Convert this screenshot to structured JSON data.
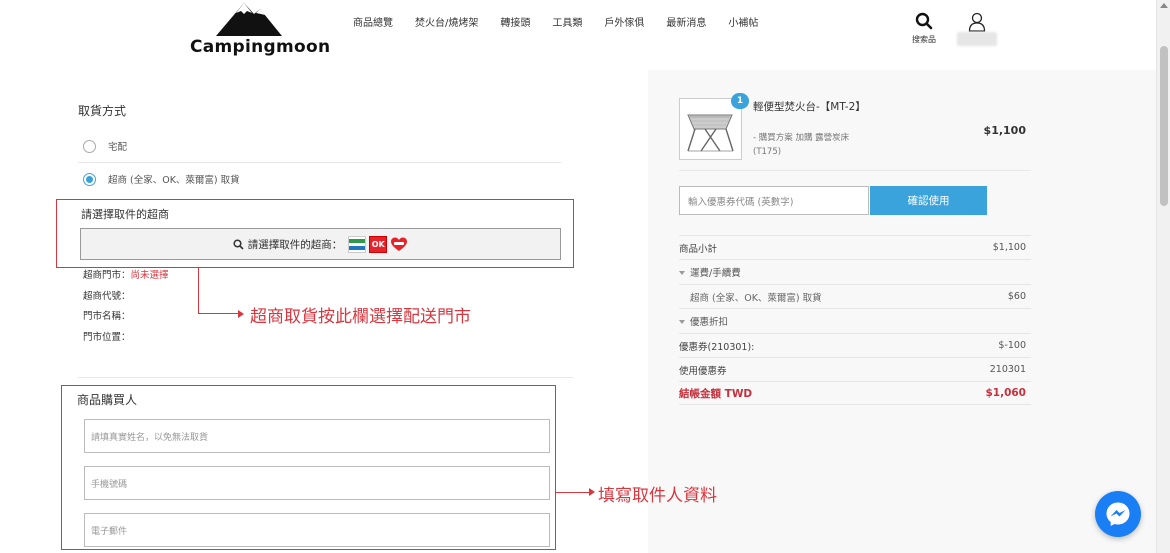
{
  "header": {
    "logo_text": "Campingmoon",
    "nav": [
      "商品總覽",
      "焚火台/燒烤架",
      "轉接頭",
      "工具類",
      "戶外傢俱",
      "最新消息",
      "小補帖"
    ],
    "search_label": "搜索品",
    "icons": {
      "search": "search-icon",
      "user": "user-icon"
    }
  },
  "pickup": {
    "title": "取貨方式",
    "options": [
      {
        "label": "宅配",
        "checked": false
      },
      {
        "label": "超商 (全家、OK、萊爾富) 取貨",
        "checked": true
      }
    ]
  },
  "store": {
    "label": "請選擇取件的超商",
    "button_label": "請選擇取件的超商：",
    "logos": [
      "FamilyMart",
      "OK",
      "Hi-Life"
    ],
    "ok_text": "OK",
    "info": [
      {
        "label": "超商門市：",
        "value": "尚未選擇"
      },
      {
        "label": "超商代號：",
        "value": ""
      },
      {
        "label": "門市名稱：",
        "value": ""
      },
      {
        "label": "門市位置：",
        "value": ""
      }
    ]
  },
  "annotations": {
    "store_note": "超商取貨按此欄選擇配送門市",
    "buyer_note": "填寫取件人資料"
  },
  "buyer": {
    "title": "商品購買人",
    "fields": [
      {
        "placeholder": "請填真實姓名，以免無法取貨"
      },
      {
        "placeholder": "手機號碼"
      },
      {
        "placeholder": "電子郵件"
      }
    ]
  },
  "cart": {
    "item": {
      "qty": "1",
      "name": "輕便型焚火台-【MT-2】",
      "options": "- 購買方案 加購 露營炭床",
      "sku": "(T175)",
      "price": "$1,100"
    },
    "coupon": {
      "placeholder": "輸入優惠券代碼 (英數字)",
      "button": "確認使用"
    },
    "summary": [
      {
        "key": "商品小計",
        "value": "$1,100",
        "type": "normal"
      },
      {
        "key": "運費/手續費",
        "value": "",
        "type": "group"
      },
      {
        "key": "超商 (全家、OK、萊爾富) 取貨",
        "value": "$60",
        "type": "indent"
      },
      {
        "key": "優惠折扣",
        "value": "",
        "type": "group"
      },
      {
        "key": "優惠券(210301):",
        "value": "$-100",
        "type": "normal"
      },
      {
        "key": "使用優惠券",
        "value": "210301",
        "type": "normal"
      },
      {
        "key": "結帳金額 TWD",
        "value": "$1,060",
        "type": "total"
      }
    ]
  },
  "colors": {
    "accent": "#3ba3dc",
    "annotation_red": "#d7373f",
    "total_red": "#c62f3c",
    "messenger_blue": "#1a7ef5"
  }
}
